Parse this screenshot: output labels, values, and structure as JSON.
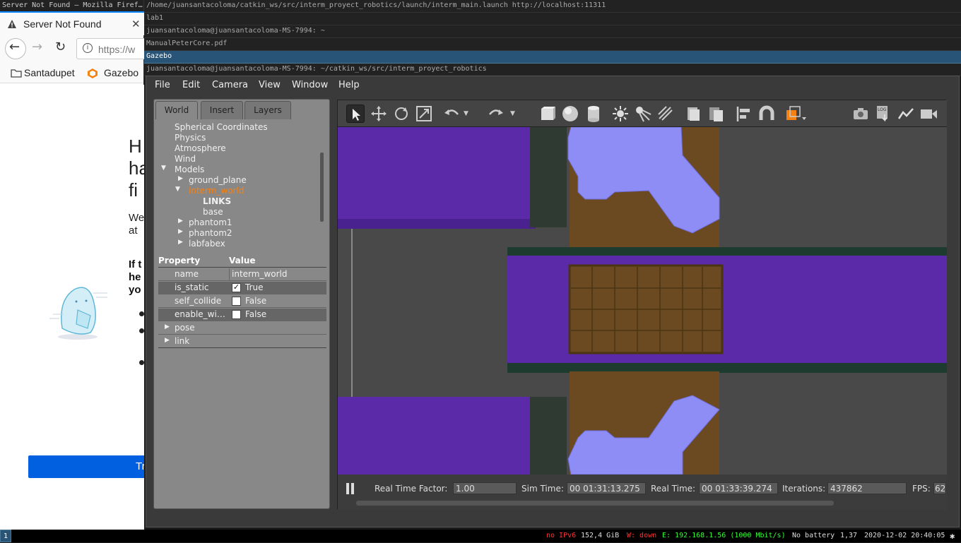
{
  "firefox": {
    "window_title": "Server Not Found — Mozilla Firef…",
    "tab_title": "Server Not Found",
    "url_partial": "https://w",
    "bookmarks": [
      "Santadupet",
      "Gazebo"
    ],
    "error_heading_lines": [
      "H",
      "ha",
      "fi"
    ],
    "error_para_lines": [
      "We",
      "at"
    ],
    "error_bold_lines": [
      "If t",
      "he",
      "yo"
    ],
    "try_button": "Tr"
  },
  "terminal_titles": [
    "/home/juansantacoloma/catkin_ws/src/interm_proyect_robotics/launch/interm_main.launch http://localhost:11311",
    "lab1",
    "juansantacoloma@juansantacoloma-MS-7994: ~",
    "ManualPeterCore.pdf",
    "Gazebo",
    "juansantacoloma@juansantacoloma-MS-7994: ~/catkin_ws/src/interm_proyect_robotics"
  ],
  "gazebo": {
    "menu": [
      "File",
      "Edit",
      "Camera",
      "View",
      "Window",
      "Help"
    ],
    "left_tabs": [
      "World",
      "Insert",
      "Layers"
    ],
    "tree": {
      "spherical": "Spherical Coordinates",
      "physics": "Physics",
      "atmosphere": "Atmosphere",
      "wind": "Wind",
      "models": "Models",
      "ground_plane": "ground_plane",
      "interm_world": "interm_world",
      "links": "LINKS",
      "base": "base",
      "phantom1": "phantom1",
      "phantom2": "phantom2",
      "labfabex": "labfabex"
    },
    "props_header": {
      "property": "Property",
      "value": "Value"
    },
    "props": {
      "name_key": "name",
      "name_val": "interm_world",
      "static_key": "is_static",
      "static_val": "True",
      "collide_key": "self_collide",
      "collide_val": "False",
      "wind_key": "enable_wi…",
      "wind_val": "False",
      "pose": "pose",
      "link": "link"
    },
    "status": {
      "rtf_label": "Real Time Factor:",
      "rtf": "1.00",
      "sim_label": "Sim Time:",
      "sim": "00 01:31:13.275",
      "real_label": "Real Time:",
      "real": "00 01:33:39.274",
      "iter_label": "Iterations:",
      "iter": "437862",
      "fps_label": "FPS:",
      "fps": "62"
    },
    "toolbar_icons": [
      "select-icon",
      "translate-icon",
      "rotate-icon",
      "scale-icon",
      "undo-icon",
      "undo-history-icon",
      "redo-icon",
      "redo-history-icon",
      "box-icon",
      "sphere-icon",
      "cylinder-icon",
      "point-light-icon",
      "spot-light-icon",
      "directional-light-icon",
      "copy-icon",
      "paste-icon",
      "align-icon",
      "snap-icon",
      "view-angle-icon",
      "screenshot-icon",
      "log-icon",
      "plot-icon",
      "record-icon"
    ]
  },
  "statusbar": {
    "workspace": "1",
    "ipv6": "no IPv6",
    "disk": "152,4 GiB",
    "wifi": "W: down",
    "eth": "E: 192.168.1.56 (1000 Mbit/s)",
    "battery": "No battery",
    "load": "1,37",
    "datetime": "2020-12-02 20:40:05"
  },
  "colors": {
    "accent_orange": "#f58113",
    "conveyor_purple": "#5a2aa8",
    "robot_part": "#8e8cf5",
    "box_brown": "#6b4a22"
  }
}
